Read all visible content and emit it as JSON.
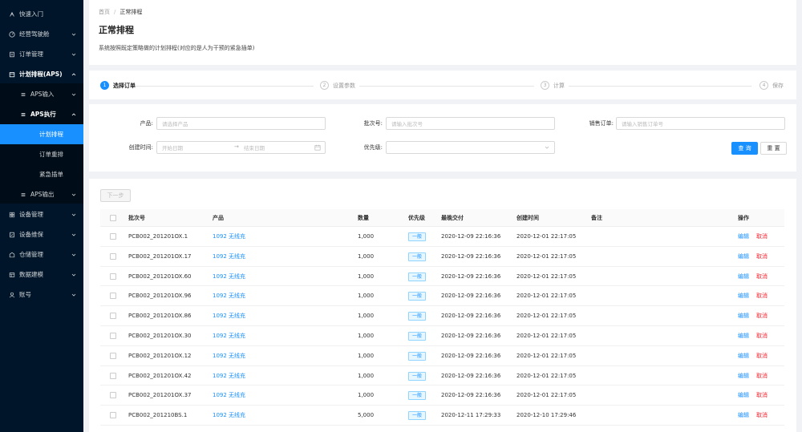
{
  "sidebar": {
    "items": [
      {
        "label": "快速入门",
        "icon": "rocket-icon"
      },
      {
        "label": "经营驾驶舱",
        "icon": "dashboard-icon"
      },
      {
        "label": "订单管理",
        "icon": "order-icon"
      },
      {
        "label": "计划排程(APS)",
        "icon": "calendar-icon"
      },
      {
        "label": "APS输入",
        "icon": "list-icon"
      },
      {
        "label": "APS执行",
        "icon": "list-icon"
      },
      {
        "label": "计划排程"
      },
      {
        "label": "订单重排"
      },
      {
        "label": "紧急插单"
      },
      {
        "label": "APS输出",
        "icon": "list-icon"
      },
      {
        "label": "设备管理",
        "icon": "grid-icon"
      },
      {
        "label": "设备维保",
        "icon": "tool-icon"
      },
      {
        "label": "仓储管理",
        "icon": "warehouse-icon"
      },
      {
        "label": "数据建模",
        "icon": "model-icon"
      },
      {
        "label": "账号",
        "icon": "user-icon"
      }
    ]
  },
  "header": {
    "breadcrumb_home": "首页",
    "breadcrumb_sep": "/",
    "breadcrumb_current": "正常排程",
    "title": "正常排程",
    "description": "系统按照既定策略做的计划排程(对应的是人为干预的紧急插单)"
  },
  "steps": [
    {
      "num": "1",
      "label": "选择订单"
    },
    {
      "num": "2",
      "label": "设置参数"
    },
    {
      "num": "3",
      "label": "计算"
    },
    {
      "num": "4",
      "label": "保存"
    }
  ],
  "filters": {
    "product_label": "产品:",
    "product_placeholder": "请选择产品",
    "batch_label": "批次号:",
    "batch_placeholder": "请输入批次号",
    "sales_label": "销售订单:",
    "sales_placeholder": "请输入销售订单号",
    "created_label": "创建时间:",
    "start_placeholder": "开始日期",
    "date_sep": "→",
    "end_placeholder": "结束日期",
    "priority_label": "优先级:",
    "query_btn": "查 询",
    "reset_btn": "重 置"
  },
  "table": {
    "next_btn": "下一步",
    "columns": [
      "批次号",
      "产品",
      "数量",
      "优先级",
      "最晚交付",
      "创建时间",
      "备注",
      "操作"
    ],
    "edit_label": "编辑",
    "cancel_label": "取消",
    "rows": [
      {
        "batch": "PCB002_201201OX.1",
        "product": "1092 无线充",
        "qty": "1,000",
        "priority": "一般",
        "due": "2020-12-09 22:16:36",
        "created": "2020-12-01 22:17:05"
      },
      {
        "batch": "PCB002_201201OX.17",
        "product": "1092 无线充",
        "qty": "1,000",
        "priority": "一般",
        "due": "2020-12-09 22:16:36",
        "created": "2020-12-01 22:17:05"
      },
      {
        "batch": "PCB002_201201OX.60",
        "product": "1092 无线充",
        "qty": "1,000",
        "priority": "一般",
        "due": "2020-12-09 22:16:36",
        "created": "2020-12-01 22:17:05"
      },
      {
        "batch": "PCB002_201201OX.96",
        "product": "1092 无线充",
        "qty": "1,000",
        "priority": "一般",
        "due": "2020-12-09 22:16:36",
        "created": "2020-12-01 22:17:05"
      },
      {
        "batch": "PCB002_201201OX.86",
        "product": "1092 无线充",
        "qty": "1,000",
        "priority": "一般",
        "due": "2020-12-09 22:16:36",
        "created": "2020-12-01 22:17:05"
      },
      {
        "batch": "PCB002_201201OX.30",
        "product": "1092 无线充",
        "qty": "1,000",
        "priority": "一般",
        "due": "2020-12-09 22:16:36",
        "created": "2020-12-01 22:17:05"
      },
      {
        "batch": "PCB002_201201OX.12",
        "product": "1092 无线充",
        "qty": "1,000",
        "priority": "一般",
        "due": "2020-12-09 22:16:36",
        "created": "2020-12-01 22:17:05"
      },
      {
        "batch": "PCB002_201201OX.42",
        "product": "1092 无线充",
        "qty": "1,000",
        "priority": "一般",
        "due": "2020-12-09 22:16:36",
        "created": "2020-12-01 22:17:05"
      },
      {
        "batch": "PCB002_201201OX.37",
        "product": "1092 无线充",
        "qty": "1,000",
        "priority": "一般",
        "due": "2020-12-09 22:16:36",
        "created": "2020-12-01 22:17:05"
      },
      {
        "batch": "PCB002_201210BS.1",
        "product": "1092 无线充",
        "qty": "5,000",
        "priority": "一般",
        "due": "2020-12-11 17:29:33",
        "created": "2020-12-10 17:29:46"
      }
    ]
  },
  "colors": {
    "primary": "#1890ff",
    "danger": "#f5222d",
    "sidebar_bg": "#001529"
  }
}
